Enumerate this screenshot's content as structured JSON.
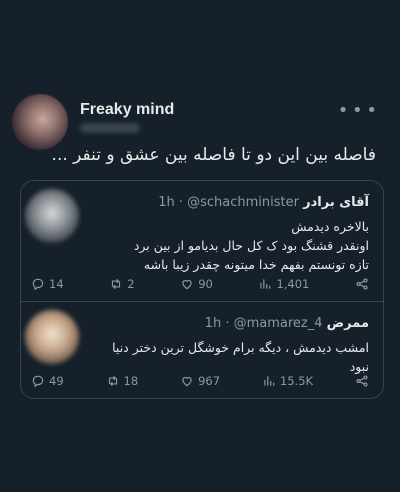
{
  "tweet": {
    "author_name": "Freaky mind",
    "text": "فاصله بین این دو تا فاصله بین عشق و تنفر ..."
  },
  "quotes": [
    {
      "name": "آقای برادر",
      "handle": "@schachminister",
      "time": "1h",
      "lines": [
        "بالاخره دیدمش",
        "اونقدر قشنگ بود ک کل حال بدیامو از بین برد",
        "تازه تونستم بفهم خدا میتونه چقدر زیبا باشه"
      ],
      "stats": {
        "replies": "14",
        "retweets": "2",
        "likes": "90",
        "views": "1,401"
      }
    },
    {
      "name": "ممرض",
      "handle": "@mamarez_4",
      "time": "1h",
      "lines": [
        "امشب دیدمش ، دیگه برام خوشگل ترین دختر دنیا",
        "نبود"
      ],
      "stats": {
        "replies": "49",
        "retweets": "18",
        "likes": "967",
        "views": "15.5K"
      }
    }
  ],
  "icons": [
    "reply-icon",
    "retweet-icon",
    "like-icon",
    "views-icon",
    "share-icon",
    "more-icon"
  ],
  "colors": {
    "background": "#15202b",
    "border": "#38444d",
    "muted": "#8b98a5",
    "text": "#e7e9ea"
  }
}
